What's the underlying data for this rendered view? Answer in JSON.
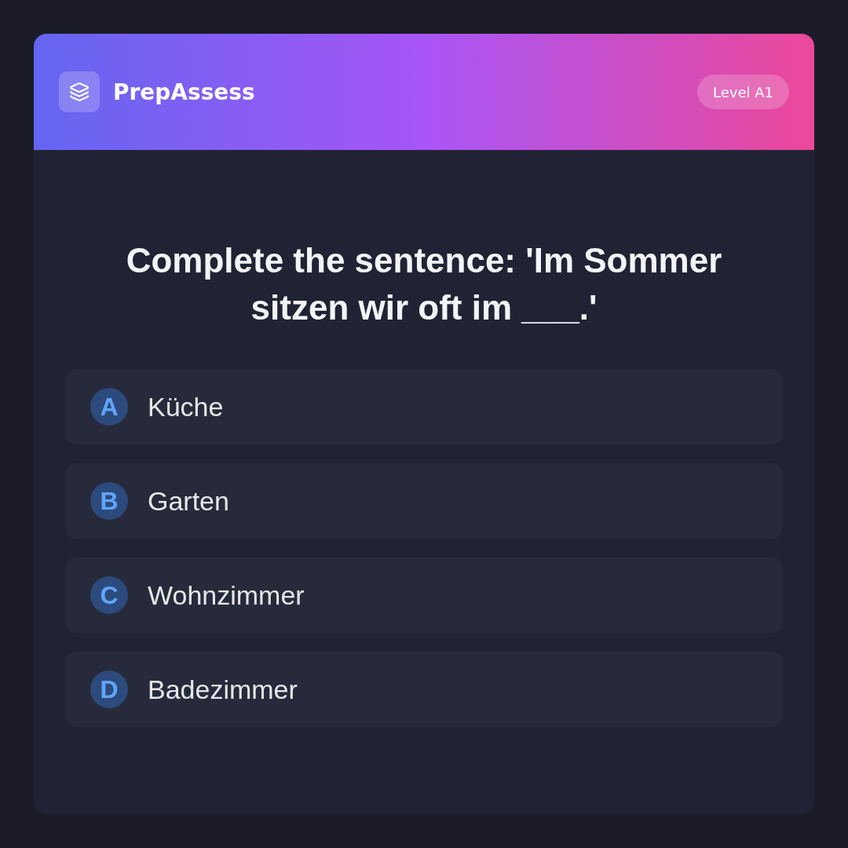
{
  "header": {
    "brand": "PrepAssess",
    "level_badge": "Level A1"
  },
  "question": "Complete the sentence: 'Im Sommer sitzen wir oft im ___.'",
  "options": [
    {
      "letter": "A",
      "text": "Küche",
      "selected": false
    },
    {
      "letter": "B",
      "text": "Garten",
      "selected": false
    },
    {
      "letter": "C",
      "text": "Wohnzimmer",
      "selected": false
    },
    {
      "letter": "D",
      "text": "Badezimmer",
      "selected": false
    }
  ]
}
